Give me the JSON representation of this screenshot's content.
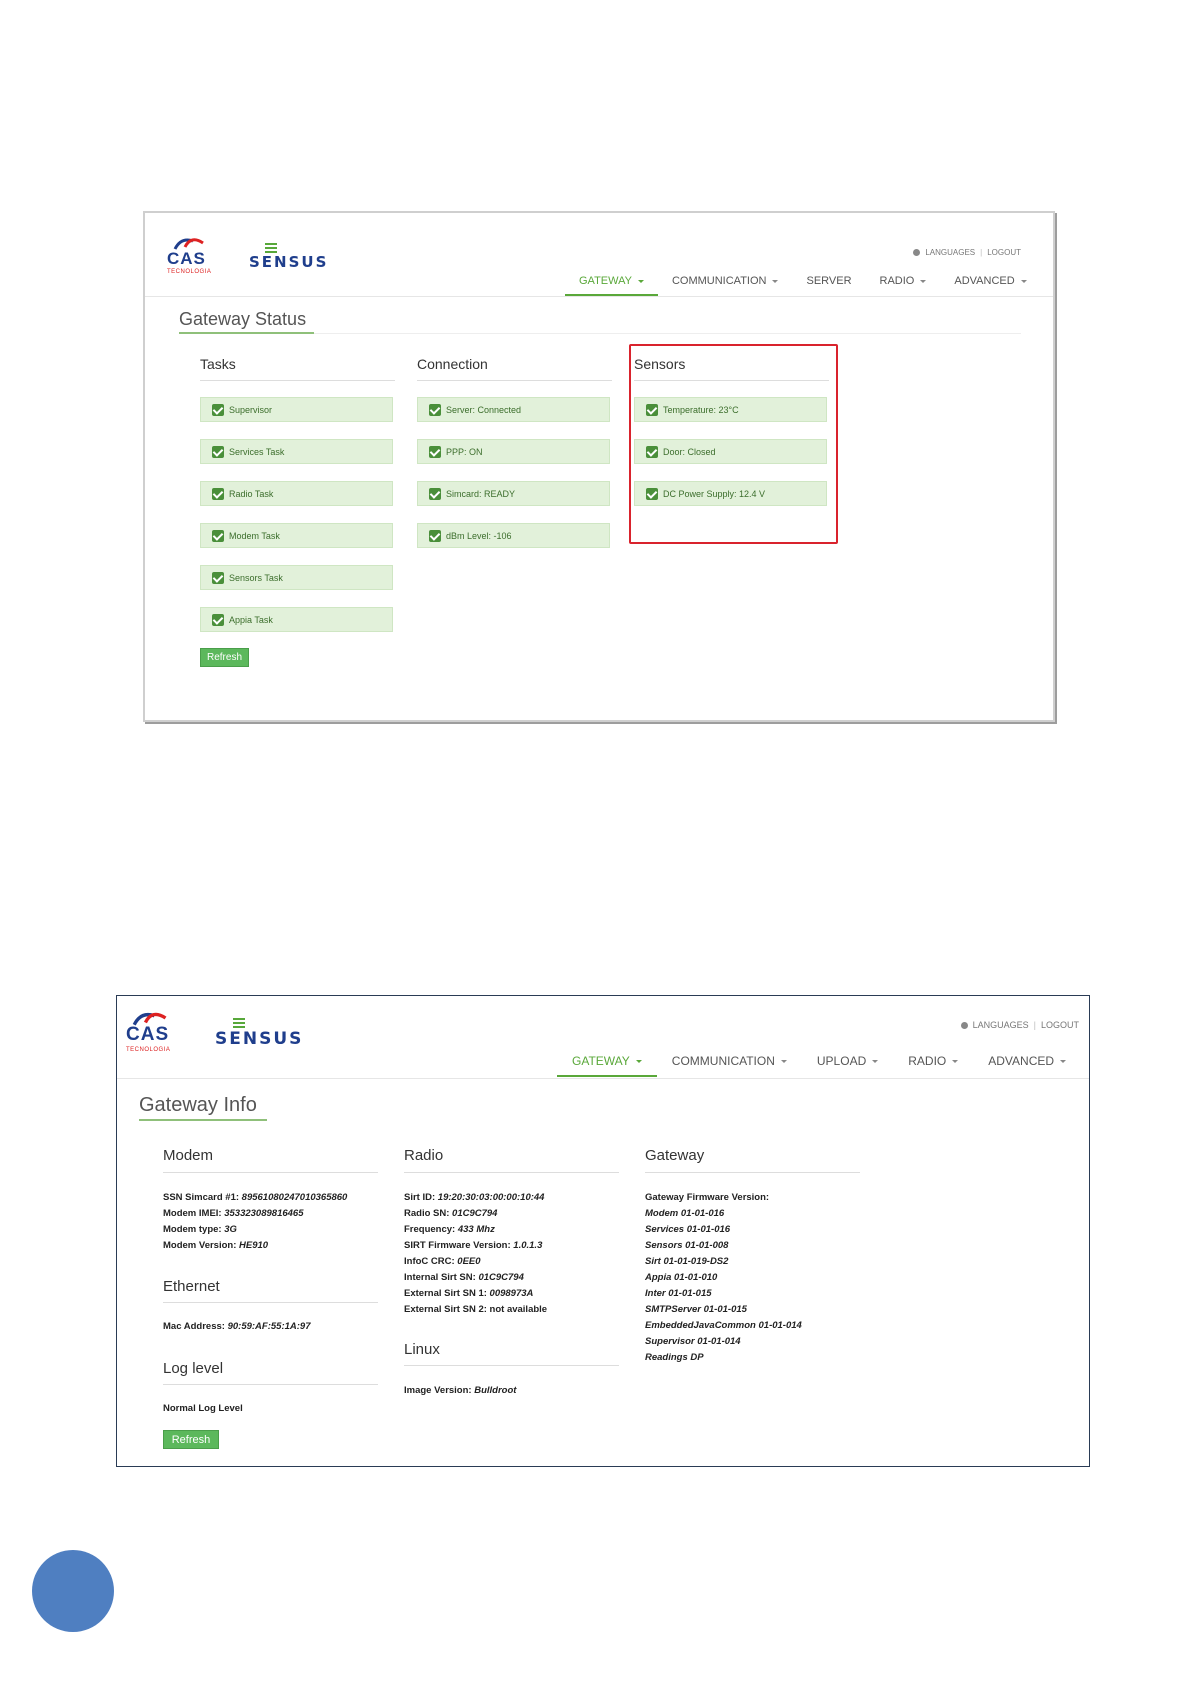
{
  "status_screen": {
    "brand": {
      "cas": "CAS",
      "cas_sub": "TECNOLOGIA",
      "sensus": "SENSUS"
    },
    "top_links": {
      "languages": "LANGUAGES",
      "logout": "LOGOUT"
    },
    "nav": [
      "GATEWAY",
      "COMMUNICATION",
      "SERVER",
      "RADIO",
      "ADVANCED"
    ],
    "title": "Gateway Status",
    "tasks": {
      "heading": "Tasks",
      "items": [
        "Supervisor",
        "Services Task",
        "Radio Task",
        "Modem Task",
        "Sensors Task",
        "Appia Task"
      ]
    },
    "connection": {
      "heading": "Connection",
      "items": [
        "Server: Connected",
        "PPP: ON",
        "Simcard: READY",
        "dBm Level: -106"
      ]
    },
    "sensors": {
      "heading": "Sensors",
      "items": [
        "Temperature: 23°C",
        "Door: Closed",
        "DC Power Supply: 12.4 V"
      ]
    },
    "refresh": "Refresh",
    "colors": {
      "accent": "#5aa83a",
      "highlight": "#d9232d"
    }
  },
  "info_screen": {
    "brand": {
      "cas": "CAS",
      "cas_sub": "TECNOLOGIA",
      "sensus": "SENSUS"
    },
    "top_links": {
      "languages": "LANGUAGES",
      "logout": "LOGOUT"
    },
    "nav": [
      "GATEWAY",
      "COMMUNICATION",
      "UPLOAD",
      "RADIO",
      "ADVANCED"
    ],
    "title": "Gateway Info",
    "modem": {
      "heading": "Modem",
      "lines": [
        {
          "label": "SSN Simcard #1: ",
          "value": "89561080247010365860"
        },
        {
          "label": "Modem IMEI: ",
          "value": "353323089816465"
        },
        {
          "label": "Modem type: ",
          "value": "3G"
        },
        {
          "label": "Modem Version: ",
          "value": "HE910"
        }
      ]
    },
    "ethernet": {
      "heading": "Ethernet",
      "lines": [
        {
          "label": "Mac Address: ",
          "value": "90:59:AF:55:1A:97"
        }
      ]
    },
    "log_level": {
      "heading": "Log level",
      "value": "Normal Log Level"
    },
    "radio": {
      "heading": "Radio",
      "lines": [
        {
          "label": "Sirt ID: ",
          "value": "19:20:30:03:00:00:10:44"
        },
        {
          "label": "Radio SN: ",
          "value": "01C9C794"
        },
        {
          "label": "Frequency: ",
          "value": "433 Mhz"
        },
        {
          "label": "SIRT Firmware Version: ",
          "value": "1.0.1.3"
        },
        {
          "label": "InfoC CRC: ",
          "value": "0EE0"
        },
        {
          "label": "Internal Sirt SN: ",
          "value": "01C9C794"
        },
        {
          "label": "External Sirt SN 1: ",
          "value": "0098973A"
        },
        {
          "label": "External Sirt SN 2: ",
          "value": "not available"
        }
      ]
    },
    "linux": {
      "heading": "Linux",
      "lines": [
        {
          "label": "Image Version: ",
          "value": "Bulldroot"
        }
      ]
    },
    "gateway": {
      "heading": "Gateway",
      "firmware_label": "Gateway Firmware Version:",
      "versions": [
        "Modem 01-01-016",
        "Services 01-01-016",
        "Sensors 01-01-008",
        "Sirt 01-01-019-DS2",
        "Appia 01-01-010",
        "Inter 01-01-015",
        "SMTPServer 01-01-015",
        "EmbeddedJavaCommon 01-01-014",
        "Supervisor 01-01-014",
        "Readings DP"
      ]
    },
    "refresh": "Refresh"
  }
}
